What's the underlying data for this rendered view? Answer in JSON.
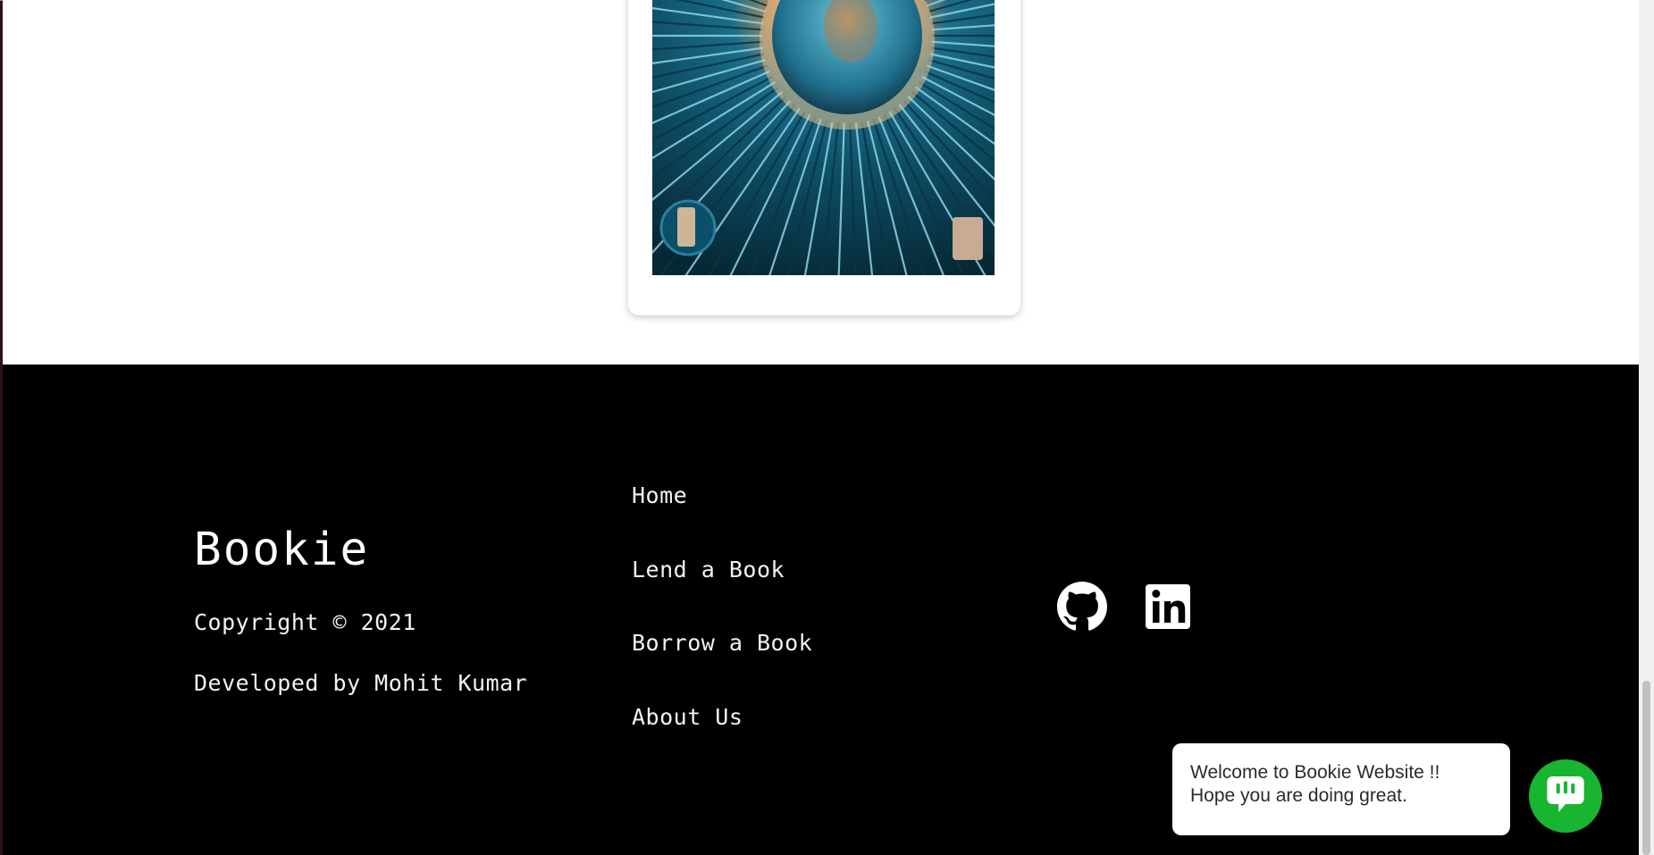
{
  "book": {
    "image_alt": "Book cover"
  },
  "footer": {
    "brand": "Bookie",
    "copyright": "Copyright © 2021",
    "developer": "Developed by Mohit Kumar",
    "nav": [
      {
        "label": "Home"
      },
      {
        "label": "Lend a Book"
      },
      {
        "label": "Borrow a Book"
      },
      {
        "label": "About Us"
      }
    ],
    "social": {
      "github_icon": "github-icon",
      "linkedin_icon": "linkedin-icon"
    }
  },
  "chat": {
    "line1": "Welcome to Bookie Website !!",
    "line2": "Hope you are doing great.",
    "accent": "#18b531",
    "icon": "chat-icon"
  },
  "colors": {
    "footer_bg": "#000000",
    "page_bg": "#ffffff"
  }
}
